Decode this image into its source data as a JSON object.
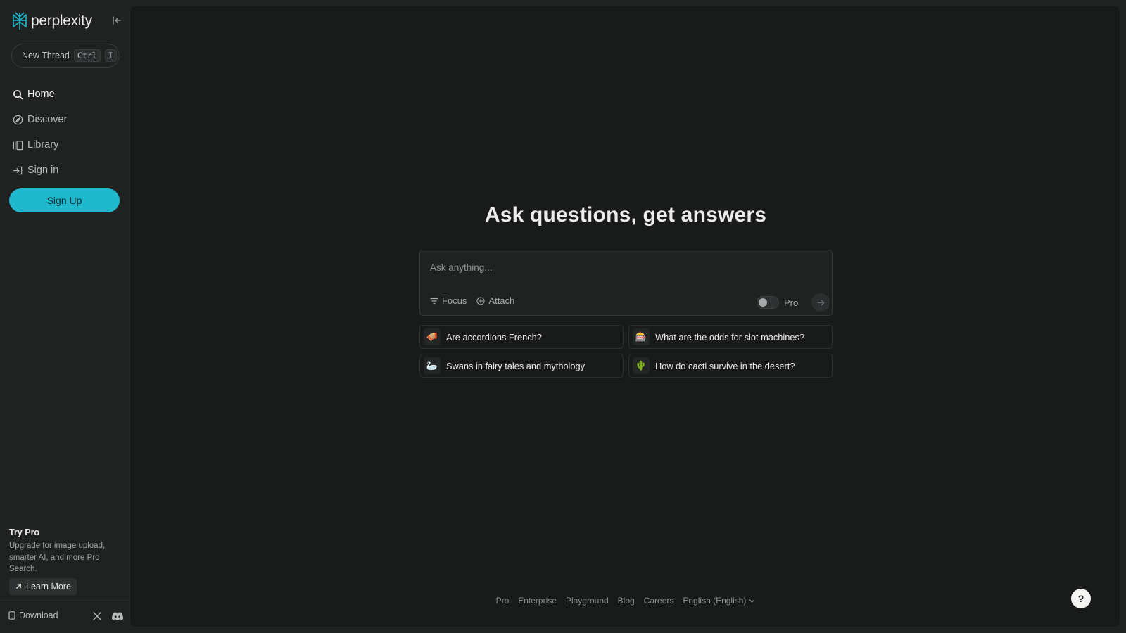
{
  "brand": {
    "name": "perplexity",
    "logo_icon": "perplexity-logo-icon",
    "accent": "#1fb8cd"
  },
  "sidebar": {
    "collapse_icon": "collapse-sidebar-icon",
    "new_thread": {
      "label": "New Thread",
      "shortcut_key1": "Ctrl",
      "shortcut_key2": "I"
    },
    "items": [
      {
        "label": "Home",
        "icon": "search-icon"
      },
      {
        "label": "Discover",
        "icon": "compass-icon"
      },
      {
        "label": "Library",
        "icon": "library-icon"
      },
      {
        "label": "Sign in",
        "icon": "sign-in-icon"
      }
    ],
    "signup_label": "Sign Up",
    "try_pro": {
      "title": "Try Pro",
      "description": "Upgrade for image upload, smarter AI, and more Pro Search.",
      "learn_more": "Learn More"
    },
    "footer": {
      "download": "Download",
      "social": [
        "x-icon",
        "discord-icon"
      ]
    }
  },
  "main": {
    "headline": "Ask questions, get answers",
    "search": {
      "placeholder": "Ask anything...",
      "focus_label": "Focus",
      "attach_label": "Attach",
      "pro_label": "Pro",
      "pro_enabled": false
    },
    "suggestions": [
      {
        "emoji": "🪗",
        "text": "Are accordions French?"
      },
      {
        "emoji": "🎰",
        "text": "What are the odds for slot machines?"
      },
      {
        "emoji": "🦢",
        "text": "Swans in fairy tales and mythology"
      },
      {
        "emoji": "🌵",
        "text": "How do cacti survive in the desert?"
      }
    ],
    "footer_links": [
      "Pro",
      "Enterprise",
      "Playground",
      "Blog",
      "Careers",
      "English (English)"
    ],
    "help_label": "?"
  }
}
